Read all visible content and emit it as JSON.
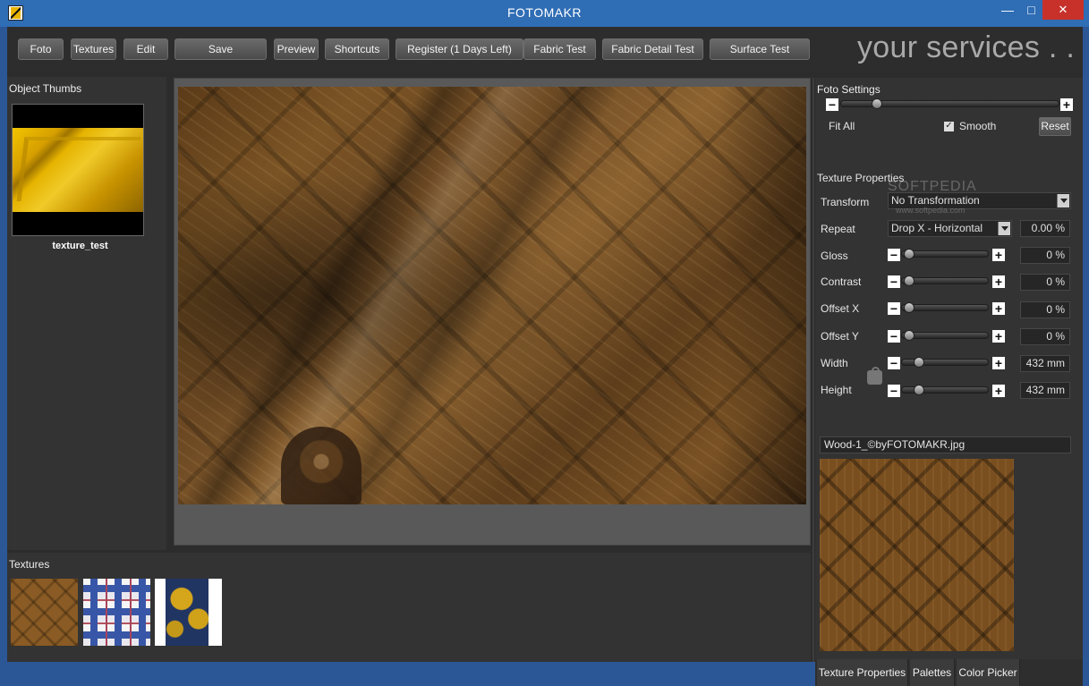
{
  "window": {
    "title": "FOTOMAKR",
    "minimize": "—",
    "maximize": "□",
    "close": "✕"
  },
  "toolbar": {
    "items": [
      "Foto",
      "Textures",
      "Edit",
      "Save",
      "Preview",
      "Shortcuts",
      "Register (1 Days Left)",
      "Fabric Test",
      "Fabric Detail Test",
      "Surface Test"
    ],
    "brand": "your services . ."
  },
  "left": {
    "object_thumbs_title": "Object Thumbs",
    "thumb_label": "texture_test",
    "textures_title": "Textures"
  },
  "foto_settings": {
    "title": "Foto Settings",
    "fit_all": "Fit All",
    "smooth_label": "Smooth",
    "smooth_checked": "✓",
    "reset_label": "Reset",
    "zoom_level": 0.15
  },
  "texture_properties": {
    "title": "Texture Properties",
    "transform_label": "Transform",
    "transform_value": "No Transformation",
    "repeat_label": "Repeat",
    "repeat_value": "Drop X - Horizontal",
    "repeat_amount": "0.00 %",
    "gloss_label": "Gloss",
    "gloss_value": "0 %",
    "contrast_label": "Contrast",
    "contrast_value": "0 %",
    "offset_x_label": "Offset X",
    "offset_x_value": "0 %",
    "offset_y_label": "Offset Y",
    "offset_y_value": "0 %",
    "width_label": "Width",
    "width_value": "432 mm",
    "height_label": "Height",
    "height_value": "432 mm",
    "filename": "Wood-1_©byFOTOMAKR.jpg"
  },
  "watermark": {
    "text": "SOFTPEDIA",
    "url": "www.softpedia.com"
  },
  "tabs": [
    "Texture Properties",
    "Palettes",
    "Color Picker"
  ],
  "icons": [
    "app-icon",
    "minus-icon",
    "plus-icon",
    "lock-icon",
    "dropdown-icon"
  ]
}
